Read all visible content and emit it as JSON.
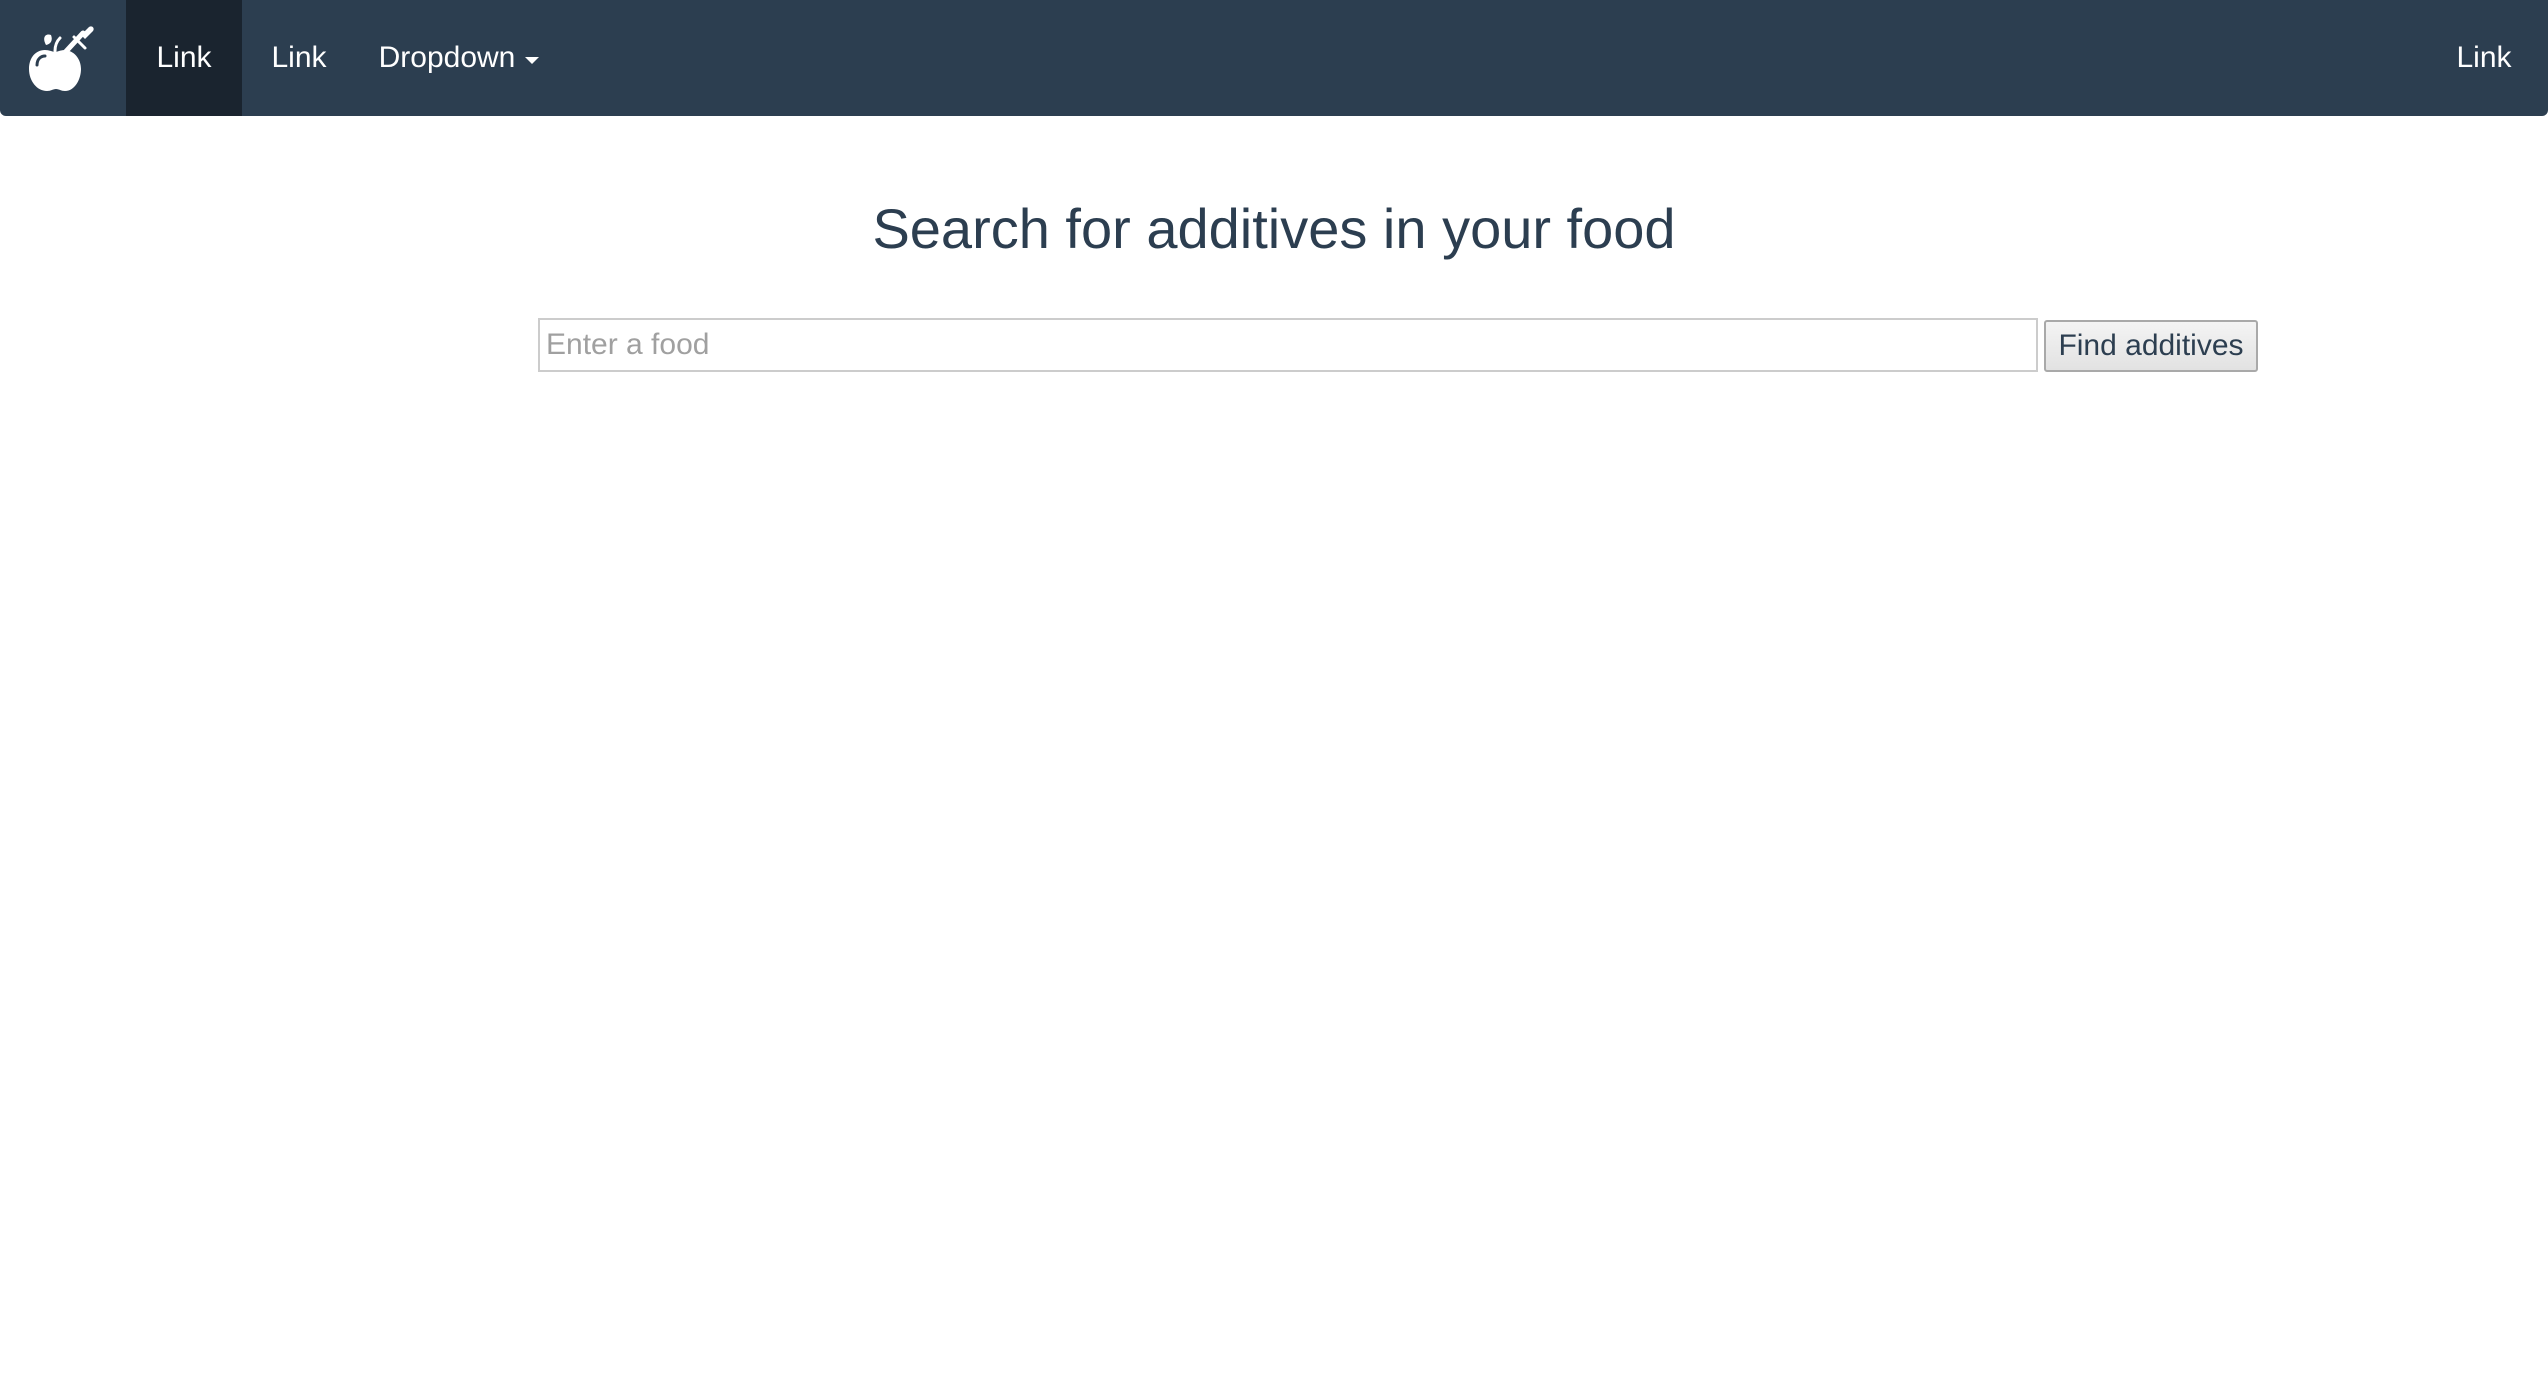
{
  "app": {
    "logo_icon": "apple-with-pen-icon"
  },
  "navbar": {
    "items": [
      {
        "label": "Link",
        "active": true
      },
      {
        "label": "Link",
        "active": false
      },
      {
        "label": "Dropdown",
        "active": false,
        "icon": "caret-down-icon"
      }
    ],
    "right_items": [
      {
        "label": "Link"
      }
    ],
    "colors": {
      "background": "#2c3e50",
      "active_background": "#1a242f",
      "text": "#ffffff"
    }
  },
  "main": {
    "title": "Search for additives in your food",
    "search": {
      "value": "",
      "placeholder": "Enter a food"
    },
    "submit_label": "Find additives"
  }
}
